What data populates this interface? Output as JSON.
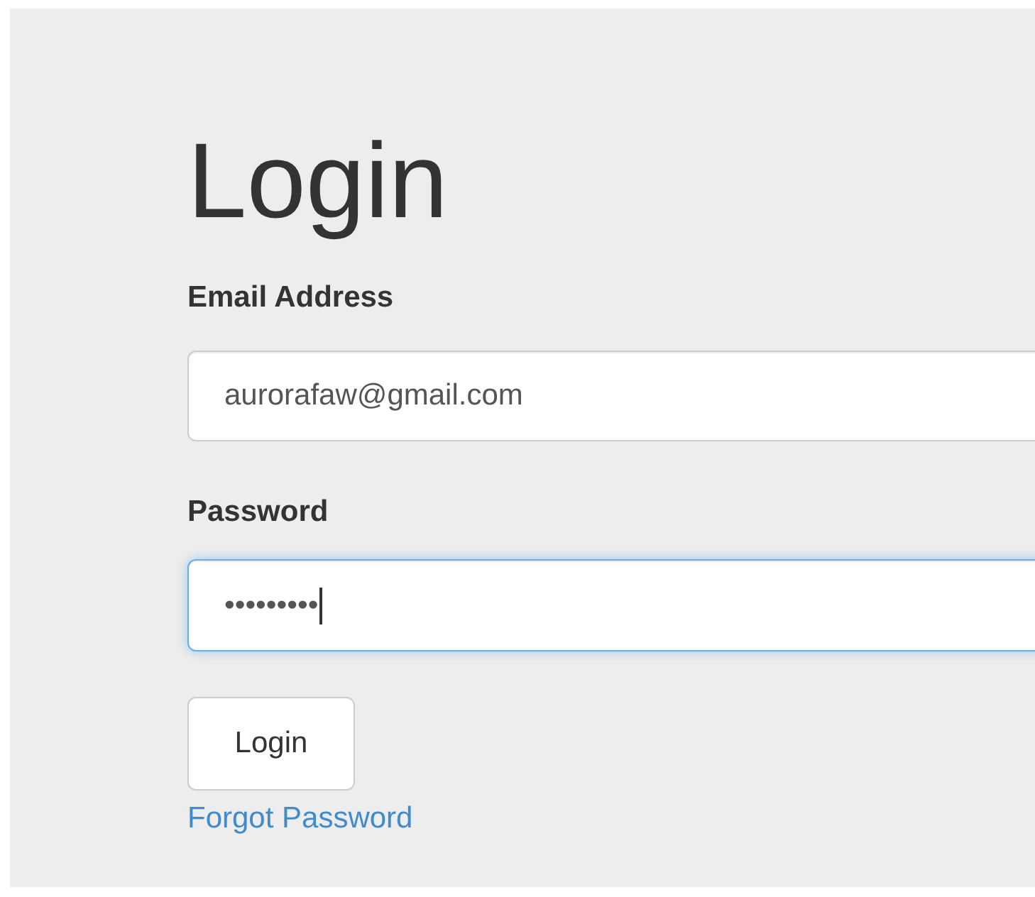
{
  "title": "Login",
  "fields": [
    {
      "label": "Email Address",
      "value": "aurorafaw@gmail.com",
      "focused": false
    },
    {
      "label": "Password",
      "value": "•••••••••",
      "focused": true
    }
  ],
  "button": "Login",
  "link": "Forgot Password"
}
